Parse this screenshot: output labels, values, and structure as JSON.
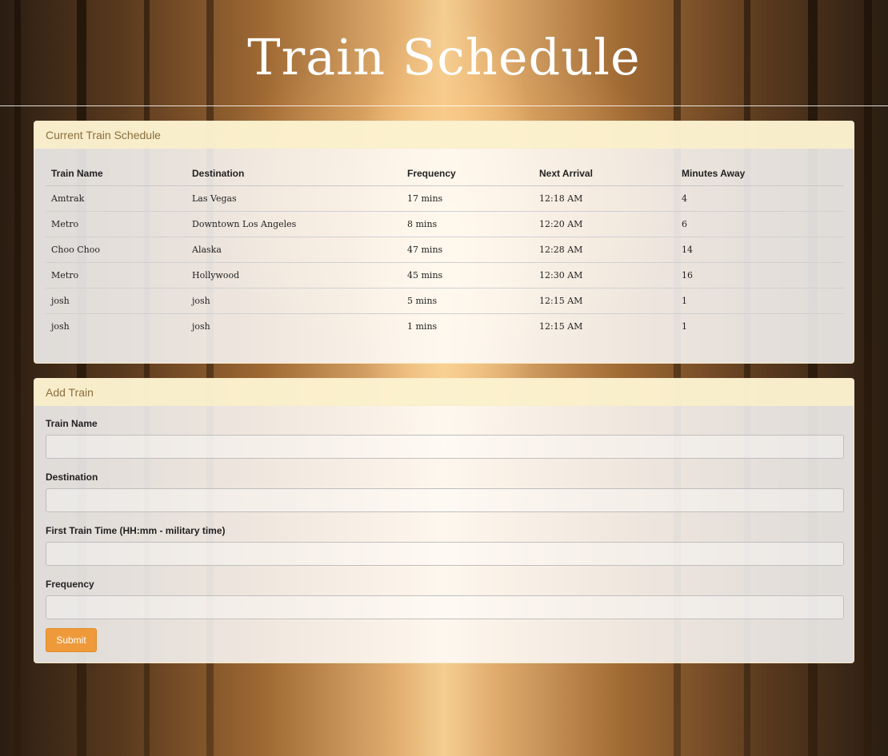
{
  "header": {
    "title": "Train Schedule"
  },
  "schedule": {
    "panel_title": "Current Train Schedule",
    "columns": [
      "Train Name",
      "Destination",
      "Frequency",
      "Next Arrival",
      "Minutes Away"
    ],
    "rows": [
      [
        "Amtrak",
        "Las Vegas",
        "17 mins",
        "12:18 AM",
        "4"
      ],
      [
        "Metro",
        "Downtown Los Angeles",
        "8 mins",
        "12:20 AM",
        "6"
      ],
      [
        "Choo Choo",
        "Alaska",
        "47 mins",
        "12:28 AM",
        "14"
      ],
      [
        "Metro",
        "Hollywood",
        "45 mins",
        "12:30 AM",
        "16"
      ],
      [
        "josh",
        "josh",
        "5 mins",
        "12:15 AM",
        "1"
      ],
      [
        "josh",
        "josh",
        "1 mins",
        "12:15 AM",
        "1"
      ]
    ]
  },
  "add_train": {
    "panel_title": "Add Train",
    "fields": {
      "train_name": {
        "label": "Train Name",
        "value": "",
        "placeholder": ""
      },
      "destination": {
        "label": "Destination",
        "value": "",
        "placeholder": ""
      },
      "first_train_time": {
        "label": "First Train Time (HH:mm - military time)",
        "value": "",
        "placeholder": ""
      },
      "frequency": {
        "label": "Frequency",
        "value": "",
        "placeholder": ""
      }
    },
    "submit_label": "Submit"
  },
  "colors": {
    "panel_heading_text": "#8a6d3b",
    "panel_heading_bg": "#fcf0c8",
    "submit_bg": "#ee9a3a",
    "title_text": "#ffffff"
  }
}
